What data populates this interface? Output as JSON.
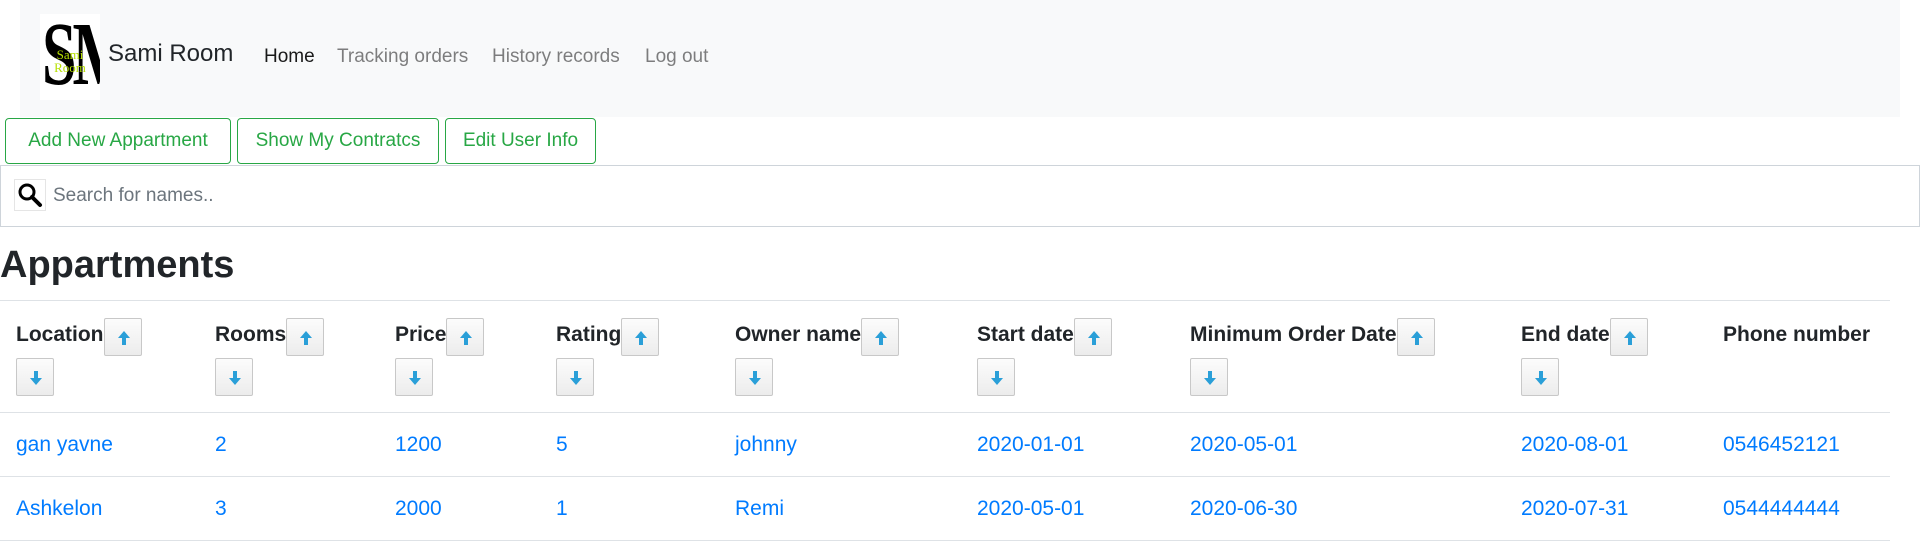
{
  "nav": {
    "logo_letters": "SM",
    "logo_text": "Sami Room",
    "brand": "Sami Room",
    "links": [
      "Home",
      "Tracking orders",
      "History records",
      "Log out"
    ]
  },
  "actions": {
    "add": "Add New Appartment",
    "contracts": "Show My Contratcs",
    "edit": "Edit User Info"
  },
  "search": {
    "placeholder": "Search for names.."
  },
  "title": "Appartments",
  "table": {
    "headers": [
      "Location",
      "Rooms",
      "Price",
      "Rating",
      "Owner name",
      "Start date",
      "Minimum Order Date",
      "End date",
      "Phone number"
    ],
    "rows": [
      [
        "gan yavne",
        "2",
        "1200",
        "5",
        "johnny",
        "2020-01-01",
        "2020-05-01",
        "2020-08-01",
        "0546452121"
      ],
      [
        "Ashkelon",
        "3",
        "2000",
        "1",
        "Remi",
        "2020-05-01",
        "2020-06-30",
        "2020-07-31",
        "0544444444"
      ]
    ]
  },
  "colors": {
    "accent_green": "#28a745",
    "link_blue": "#007bff",
    "navbar_bg": "#f8f9fa"
  }
}
